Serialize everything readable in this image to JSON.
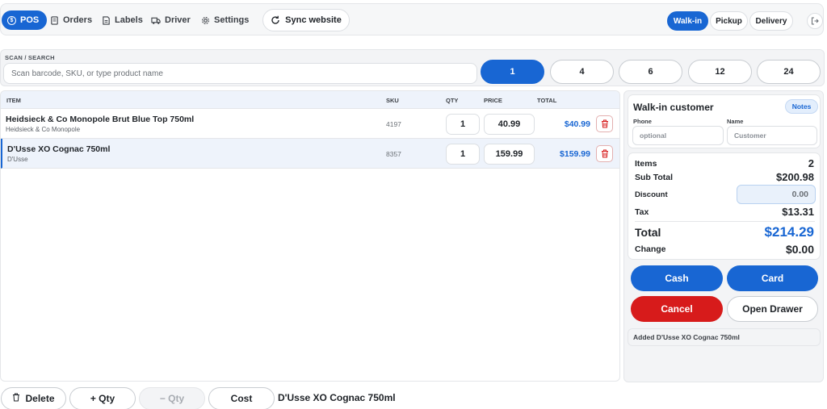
{
  "topnav": {
    "items": [
      {
        "label": "POS",
        "icon": "dollar-circle-icon"
      },
      {
        "label": "Orders",
        "icon": "receipt-icon"
      },
      {
        "label": "Labels",
        "icon": "label-icon"
      },
      {
        "label": "Driver",
        "icon": "truck-icon"
      },
      {
        "label": "Settings",
        "icon": "gear-icon"
      }
    ],
    "sync_label": "Sync website",
    "modes": [
      "Walk-in",
      "Pickup",
      "Delivery"
    ],
    "active_mode": "Walk-in"
  },
  "scan": {
    "label": "SCAN / SEARCH",
    "placeholder": "Scan barcode, SKU, or type product name",
    "qty_presets": [
      "1",
      "4",
      "6",
      "12",
      "24"
    ],
    "active_preset": "1"
  },
  "cart": {
    "headers": {
      "item": "ITEM",
      "sku": "SKU",
      "qty": "QTY",
      "price": "PRICE",
      "total": "TOTAL"
    },
    "rows": [
      {
        "name": "Heidsieck & Co Monopole Brut Blue Top 750ml",
        "brand": "Heidsieck & Co Monopole",
        "sku": "4197",
        "qty": "1",
        "price": "40.99",
        "total": "$40.99",
        "selected": false
      },
      {
        "name": "D'Usse XO Cognac 750ml",
        "brand": "D'Usse",
        "sku": "8357",
        "qty": "1",
        "price": "159.99",
        "total": "$159.99",
        "selected": true
      }
    ]
  },
  "actions": {
    "delete": "Delete",
    "add_qty": "+ Qty",
    "sub_qty": "− Qty",
    "cost": "Cost",
    "selected_item": "D'Usse XO Cognac 750ml"
  },
  "customer": {
    "title": "Walk-in customer",
    "notes_label": "Notes",
    "phone_label": "Phone",
    "phone_placeholder": "optional",
    "name_label": "Name",
    "name_placeholder": "Customer"
  },
  "totals": {
    "items_label": "Items",
    "items_value": "2",
    "subtotal_label": "Sub Total",
    "subtotal_value": "$200.98",
    "discount_label": "Discount",
    "discount_value": "0.00",
    "tax_label": "Tax",
    "tax_value": "$13.31",
    "total_label": "Total",
    "total_value": "$214.29",
    "change_label": "Change",
    "change_value": "$0.00"
  },
  "payment": {
    "cash": "Cash",
    "card": "Card",
    "cancel": "Cancel",
    "open_drawer": "Open Drawer"
  },
  "log": {
    "message": "Added D'Usse XO Cognac 750ml"
  },
  "colors": {
    "accent": "#1866d3",
    "danger": "#d71b1b"
  }
}
